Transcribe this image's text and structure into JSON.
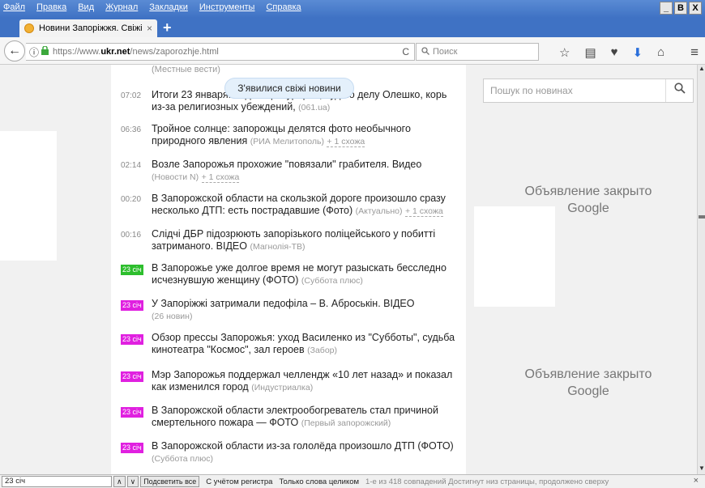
{
  "menu": [
    "Файл",
    "Правка",
    "Вид",
    "Журнал",
    "Закладки",
    "Инструменты",
    "Справка"
  ],
  "window_buttons": [
    "_",
    "B",
    "X"
  ],
  "tab": {
    "title": "Новини Запоріжжя. Свіжі За...",
    "close": "×",
    "new_tab": "+"
  },
  "nav": {
    "back": "←",
    "info": "ⓘ",
    "lock": "🔒",
    "url_prefix": "https://www.",
    "url_domain": "ukr.net",
    "url_path": "/news/zaporozhje.html",
    "reload": "C",
    "search_placeholder": "Поиск",
    "icons": [
      "☆",
      "▤",
      "♥",
      "⬇",
      "⌂"
    ],
    "menu": "≡"
  },
  "news": {
    "top_source": "(Местные вести)",
    "toast": "З'явилися свіжі новини",
    "items": [
      {
        "time": "07:02",
        "text": "Итоги 23 января: ... для прокуроров, суд по делу Олешко, корь из-за религиозных убеждений,",
        "source": "(061.ua)",
        "more": ""
      },
      {
        "time": "06:36",
        "text": "Тройное солнце: запорожцы делятся фото необычного природного явления",
        "source": "(РИА Мелитополь)",
        "more": "+ 1 схожа"
      },
      {
        "time": "02:14",
        "text": "Возле Запорожья прохожие \"повязали\" грабителя. Видео",
        "source": "(Новости N)",
        "more": "+ 1 схожа"
      },
      {
        "time": "00:20",
        "text": "В Запорожской области на скользкой дороге произошло сразу несколько ДТП: есть пострадавшие (Фото)",
        "source": "(Актуально)",
        "more": "+ 1 схожа"
      },
      {
        "time": "00:16",
        "text": "Слідчі ДБР підозрюють запорізького поліцейського у побитті затриманого. ВІДЕО",
        "source": "(Магнолія-ТВ)",
        "more": ""
      },
      {
        "time": "23 січ",
        "text": "В Запорожье уже долгое время не могут разыскать бесследно исчезнувшую женщину (ФОТО)",
        "source": "(Суббота плюс)",
        "more": ""
      },
      {
        "time": "23 січ",
        "text": "У Запоріжжі затримали педофіла – В. Аброськін. ВІДЕО",
        "source": "(26 новин)",
        "more": ""
      },
      {
        "time": "23 січ",
        "text": "Обзор прессы Запорожья: уход Василенко из \"Субботы\", судьба кинотеатра \"Космос\", зал героев",
        "source": "(Забор)",
        "more": ""
      },
      {
        "time": "23 січ",
        "text": "Мэр Запорожья поддержал челлендж «10 лет назад» и показал как изменился город",
        "source": "(Индустриалка)",
        "more": ""
      },
      {
        "time": "23 січ",
        "text": "В Запорожской области электрообогреватель стал причиной смертельного пожара — ФОТО",
        "source": "(Первый запорожский)",
        "more": ""
      },
      {
        "time": "23 січ",
        "text": "В Запорожской области из-за гололёда произошло ДТП (ФОТО)",
        "source": "(Суббота плюс)",
        "more": ""
      }
    ]
  },
  "sidebar": {
    "search_placeholder": "Пошук по новинах",
    "search_icon": "🔍",
    "ad1_line1": "Объявление закрыто",
    "ad1_line2": "Google",
    "ad2_line1": "Объявление закрыто",
    "ad2_line2": "Google"
  },
  "scrollbar": {
    "up": "▲",
    "down": "▼"
  },
  "findbar": {
    "value": "23 січ",
    "prev": "∧",
    "next": "∨",
    "highlight_all": "Подсветить все",
    "match_case": "С учётом регистра",
    "whole_words": "Только слова целиком",
    "status": "1-е из 418 совпадений  Достигнут низ страницы, продолжено сверху",
    "close": "×"
  },
  "colors": {
    "titlebar": "#3f72c4",
    "badge_green": "#2dbe2d",
    "badge_magenta": "#e020e0",
    "toast_bg": "#e4f0fb"
  }
}
